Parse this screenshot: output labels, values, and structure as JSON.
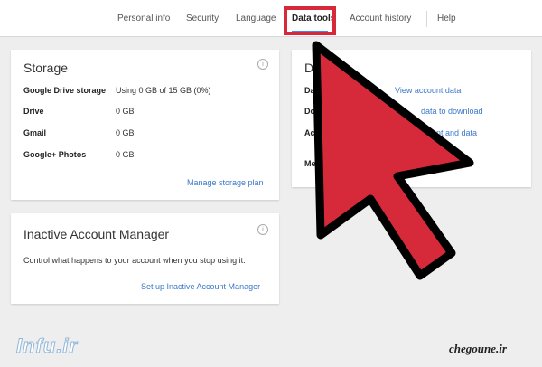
{
  "tabs": [
    {
      "label": "Personal info"
    },
    {
      "label": "Security"
    },
    {
      "label": "Language"
    },
    {
      "label": "Data tools",
      "active": true
    },
    {
      "label": "Account history"
    },
    {
      "label": "Help"
    }
  ],
  "storage": {
    "title": "Storage",
    "rows": [
      {
        "label": "Google Drive storage",
        "value": "Using 0 GB of 15 GB (0%)"
      },
      {
        "label": "Drive",
        "value": "0 GB"
      },
      {
        "label": "Gmail",
        "value": "0 GB"
      },
      {
        "label": "Google+ Photos",
        "value": "0 GB"
      }
    ],
    "manage_link": "Manage storage plan"
  },
  "inactive": {
    "title": "Inactive Account Manager",
    "description": "Control what happens to your account when you stop using it.",
    "setup_link": "Set up Inactive Account Manager"
  },
  "data_card": {
    "title": "Da",
    "rows": [
      {
        "label": "Das",
        "link": "View account data"
      },
      {
        "label": "Dow",
        "link": "data to download"
      },
      {
        "label": "Acc",
        "link": "nt and data"
      },
      {
        "label": "Me"
      }
    ]
  },
  "watermarks": {
    "left": "Infu.ir",
    "right": "chegoune.ir"
  },
  "colors": {
    "accent": "#4285f4",
    "highlight": "#d62a3a",
    "link": "#3b78c9",
    "arrow": "#d62a3a"
  },
  "icons": {
    "info": "info-icon",
    "pointer": "red-arrow-pointer"
  }
}
